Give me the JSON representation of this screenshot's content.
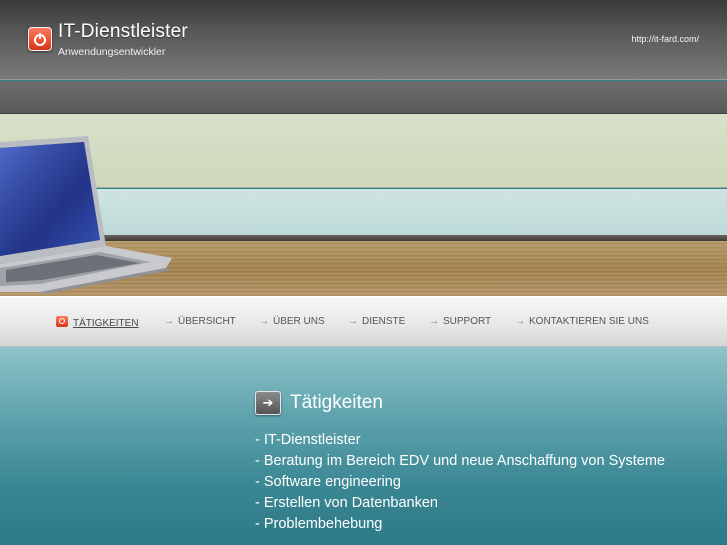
{
  "header": {
    "title": "IT-Dienstleister",
    "subtitle": "Anwendungsentwickler",
    "url": "http://it-fard.com/"
  },
  "icons": {
    "logo": "power-icon",
    "section": "arrow-right-icon",
    "nav_active": "power-icon",
    "nav_arrow": "arrow-right-icon"
  },
  "colors": {
    "accent": "#e04a2c",
    "content_bg": "#3a8793",
    "header_bg": "#5b5b5b"
  },
  "nav": {
    "items": [
      {
        "label": "TÄTIGKEITEN",
        "active": true
      },
      {
        "label": "ÜBERSICHT",
        "active": false
      },
      {
        "label": "ÜBER UNS",
        "active": false
      },
      {
        "label": "DIENSTE",
        "active": false
      },
      {
        "label": "SUPPORT",
        "active": false
      },
      {
        "label": "KONTAKTIEREN SIE UNS",
        "active": false
      }
    ]
  },
  "section": {
    "title": "Tätigkeiten",
    "items": [
      "- IT-Dienstleister",
      "- Beratung im Bereich EDV und neue Anschaffung von Systeme",
      "- Software engineering",
      "- Erstellen von Datenbanken",
      "- Problembehebung"
    ]
  }
}
